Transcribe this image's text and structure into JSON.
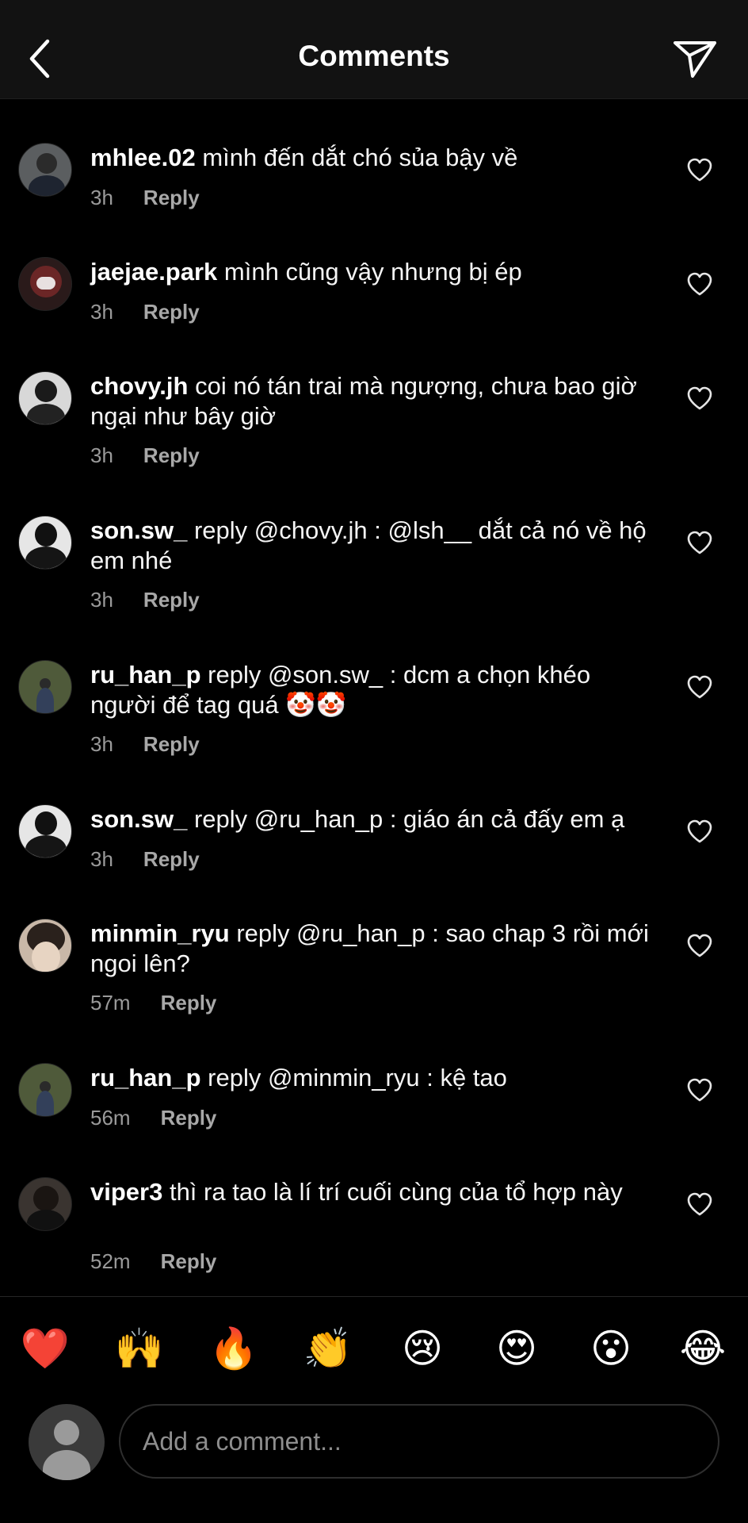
{
  "header": {
    "title": "Comments"
  },
  "reply_label": "Reply",
  "comments": [
    {
      "username": "mhlee.02",
      "text": " mình đến dắt chó sủa bậy về",
      "time": "3h"
    },
    {
      "username": "jaejae.park",
      "text": " mình cũng vậy nhưng bị ép",
      "time": "3h"
    },
    {
      "username": "chovy.jh",
      "text": " coi nó tán trai mà ngượng, chưa bao giờ ngại như bây giờ",
      "time": "3h"
    },
    {
      "username": "son.sw_",
      "text": " reply @chovy.jh : @lsh__ dắt cả nó về hộ em nhé",
      "time": "3h"
    },
    {
      "username": "ru_han_p",
      "text": " reply @son.sw_ : dcm a chọn khéo người để tag quá 🤡🤡",
      "time": "3h"
    },
    {
      "username": "son.sw_",
      "text": " reply @ru_han_p : giáo án cả đấy em ạ",
      "time": "3h"
    },
    {
      "username": "minmin_ryu",
      "text": " reply @ru_han_p : sao chap 3 rồi mới ngoi lên?",
      "time": "57m"
    },
    {
      "username": "ru_han_p",
      "text": " reply @minmin_ryu : kệ tao",
      "time": "56m"
    },
    {
      "username": "viper3",
      "text": " thì ra tao là lí trí cuối cùng của tổ hợp này",
      "time": "52m"
    }
  ],
  "emoji_bar": [
    "❤️",
    "🙌",
    "🔥",
    "👏",
    "😢",
    "😍",
    "😮",
    "😂"
  ],
  "composer": {
    "placeholder": "Add a comment..."
  },
  "colors": {
    "background": "#000000",
    "header": "#121212",
    "muted": "#9a9a9a",
    "heart": "#e5e5e5"
  }
}
